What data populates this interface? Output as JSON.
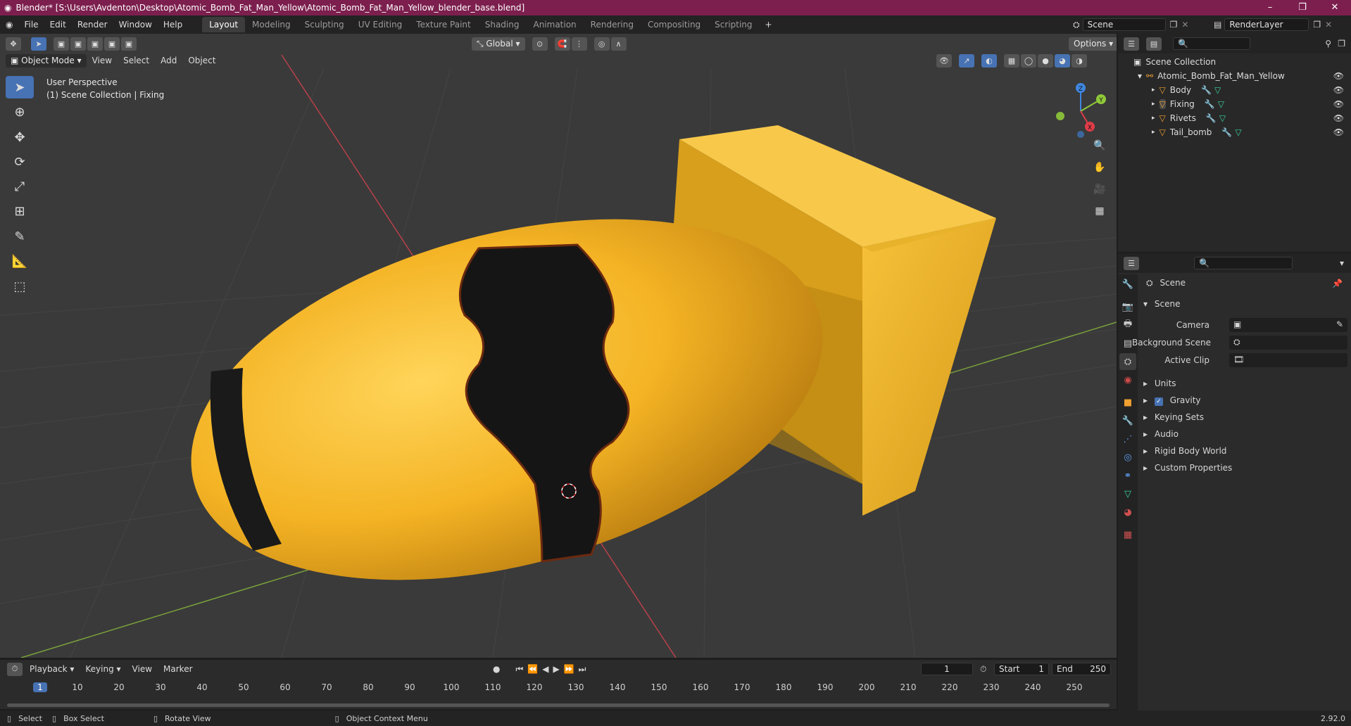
{
  "window": {
    "title": "Blender* [S:\\Users\\Avdenton\\Desktop\\Atomic_Bomb_Fat_Man_Yellow\\Atomic_Bomb_Fat_Man_Yellow_blender_base.blend]"
  },
  "menu": [
    "File",
    "Edit",
    "Render",
    "Window",
    "Help"
  ],
  "workspaces": [
    "Layout",
    "Modeling",
    "Sculpting",
    "UV Editing",
    "Texture Paint",
    "Shading",
    "Animation",
    "Rendering",
    "Compositing",
    "Scripting"
  ],
  "scene_field": "Scene",
  "renderlayer_field": "RenderLayer",
  "viewport": {
    "transform_orientation": "Global",
    "options_label": "Options",
    "mode": "Object Mode",
    "header_menus": [
      "View",
      "Select",
      "Add",
      "Object"
    ],
    "overlay_line1": "User Perspective",
    "overlay_line2": "(1) Scene Collection | Fixing",
    "gizmo_axes": {
      "z": "Z",
      "y": "Y",
      "x": "X"
    }
  },
  "outliner": {
    "root": "Scene Collection",
    "collection": "Atomic_Bomb_Fat_Man_Yellow",
    "objects": [
      "Body",
      "Fixing",
      "Rivets",
      "Tail_bomb"
    ]
  },
  "properties": {
    "context": "Scene",
    "panel": "Scene",
    "labels": {
      "camera": "Camera",
      "background": "Background Scene",
      "clip": "Active Clip"
    },
    "sections": [
      "Units",
      "Gravity",
      "Keying Sets",
      "Audio",
      "Rigid Body World",
      "Custom Properties"
    ]
  },
  "timeline": {
    "menus": [
      "Playback",
      "Keying",
      "View",
      "Marker"
    ],
    "current_frame": "1",
    "start_label": "Start",
    "start": "1",
    "end_label": "End",
    "end": "250",
    "ruler": [
      "1",
      "10",
      "20",
      "30",
      "40",
      "50",
      "60",
      "70",
      "80",
      "90",
      "100",
      "110",
      "120",
      "130",
      "140",
      "150",
      "160",
      "170",
      "180",
      "190",
      "200",
      "210",
      "220",
      "230",
      "240",
      "250"
    ]
  },
  "statusbar": {
    "select": "Select",
    "box_select": "Box Select",
    "rotate": "Rotate View",
    "context_menu": "Object Context Menu",
    "version": "2.92.0"
  },
  "colors": {
    "titlebar": "#7c1f4e",
    "accent": "#4772b3",
    "bomb_yellow": "#f4b324",
    "x_axis": "#e03c48",
    "y_axis": "#8fc93a",
    "z_axis": "#3f86e0"
  }
}
